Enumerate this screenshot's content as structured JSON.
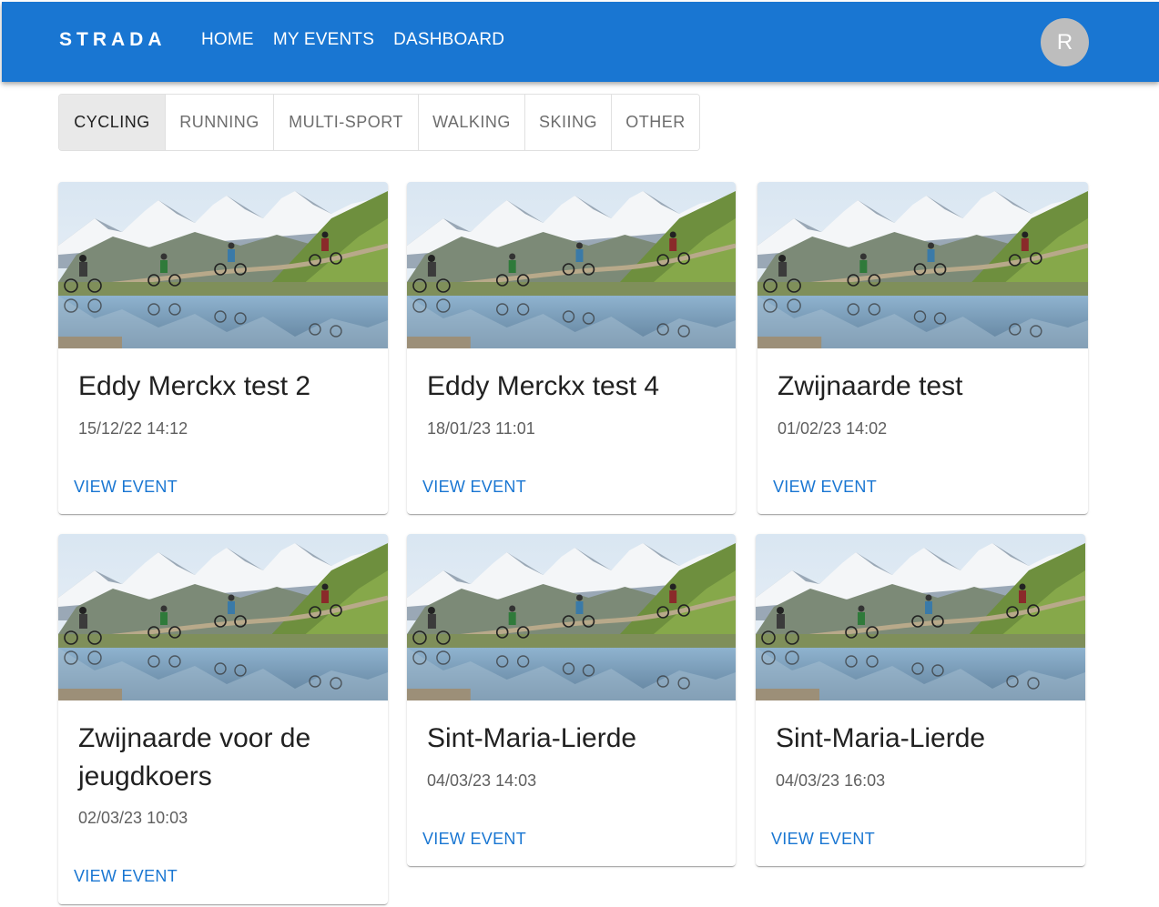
{
  "header": {
    "brand": "STRADA",
    "nav": [
      "HOME",
      "MY EVENTS",
      "DASHBOARD"
    ],
    "avatar_initial": "R"
  },
  "tabs": [
    "CYCLING",
    "RUNNING",
    "MULTI-SPORT",
    "WALKING",
    "SKIING",
    "OTHER"
  ],
  "active_tab": "CYCLING",
  "events": [
    {
      "title": "Eddy Merckx test 2",
      "date": "15/12/22 14:12",
      "action": "VIEW EVENT"
    },
    {
      "title": "Eddy Merckx test 4",
      "date": "18/01/23 11:01",
      "action": "VIEW EVENT"
    },
    {
      "title": "Zwijnaarde test",
      "date": "01/02/23 14:02",
      "action": "VIEW EVENT"
    },
    {
      "title": "Zwijnaarde voor de jeugdkoers",
      "date": "02/03/23 10:03",
      "action": "VIEW EVENT"
    },
    {
      "title": "Sint-Maria-Lierde",
      "date": "04/03/23 14:03",
      "action": "VIEW EVENT"
    },
    {
      "title": "Sint-Maria-Lierde",
      "date": "04/03/23 16:03",
      "action": "VIEW EVENT"
    }
  ],
  "colors": {
    "primary": "#1976d2",
    "avatar": "#bdbdbd",
    "active_tab_bg": "#e9e9e9"
  }
}
